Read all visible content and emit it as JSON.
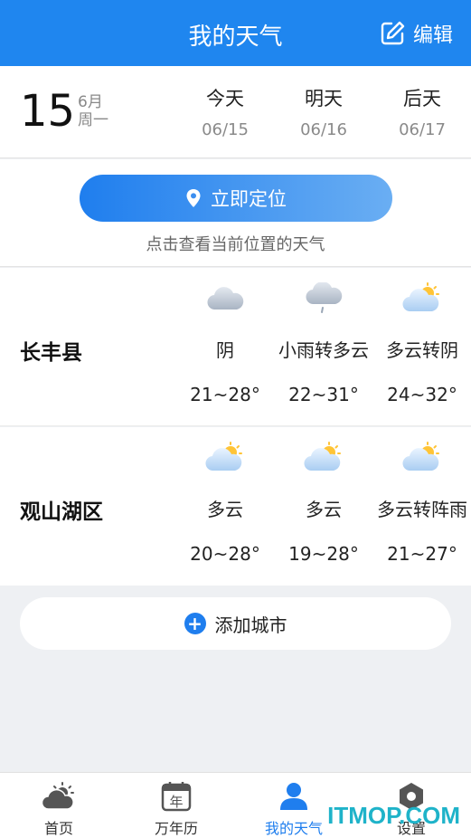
{
  "header": {
    "title": "我的天气",
    "edit_label": "编辑"
  },
  "date": {
    "day_number": "15",
    "month": "6月",
    "weekday": "周一",
    "days": [
      {
        "name": "今天",
        "date": "06/15"
      },
      {
        "name": "明天",
        "date": "06/16"
      },
      {
        "name": "后天",
        "date": "06/17"
      }
    ]
  },
  "locate": {
    "button_label": "立即定位",
    "hint": "点击查看当前位置的天气"
  },
  "cities": [
    {
      "name": "长丰县",
      "forecast": [
        {
          "icon": "cloud-icon",
          "condition": "阴",
          "temp": "21~28°"
        },
        {
          "icon": "rain-cloud-icon",
          "condition": "小雨转多云",
          "temp": "22~31°"
        },
        {
          "icon": "partly-cloudy-icon",
          "condition": "多云转阴",
          "temp": "24~32°"
        }
      ]
    },
    {
      "name": "观山湖区",
      "forecast": [
        {
          "icon": "partly-cloudy-icon",
          "condition": "多云",
          "temp": "20~28°"
        },
        {
          "icon": "partly-cloudy-icon",
          "condition": "多云",
          "temp": "19~28°"
        },
        {
          "icon": "partly-cloudy-icon",
          "condition": "多云转阵雨",
          "temp": "21~27°"
        }
      ]
    }
  ],
  "add_city_label": "添加城市",
  "tabs": [
    {
      "label": "首页",
      "icon": "weather-home-icon"
    },
    {
      "label": "万年历",
      "icon": "calendar-icon",
      "icon_text": "年"
    },
    {
      "label": "我的天气",
      "icon": "user-icon",
      "active": true
    },
    {
      "label": "设置",
      "icon": "settings-icon"
    }
  ],
  "watermark": "ITMOP.COM",
  "colors": {
    "accent": "#1f86ef",
    "active_tab": "#1f7eee",
    "watermark": "#1fb3c9"
  }
}
